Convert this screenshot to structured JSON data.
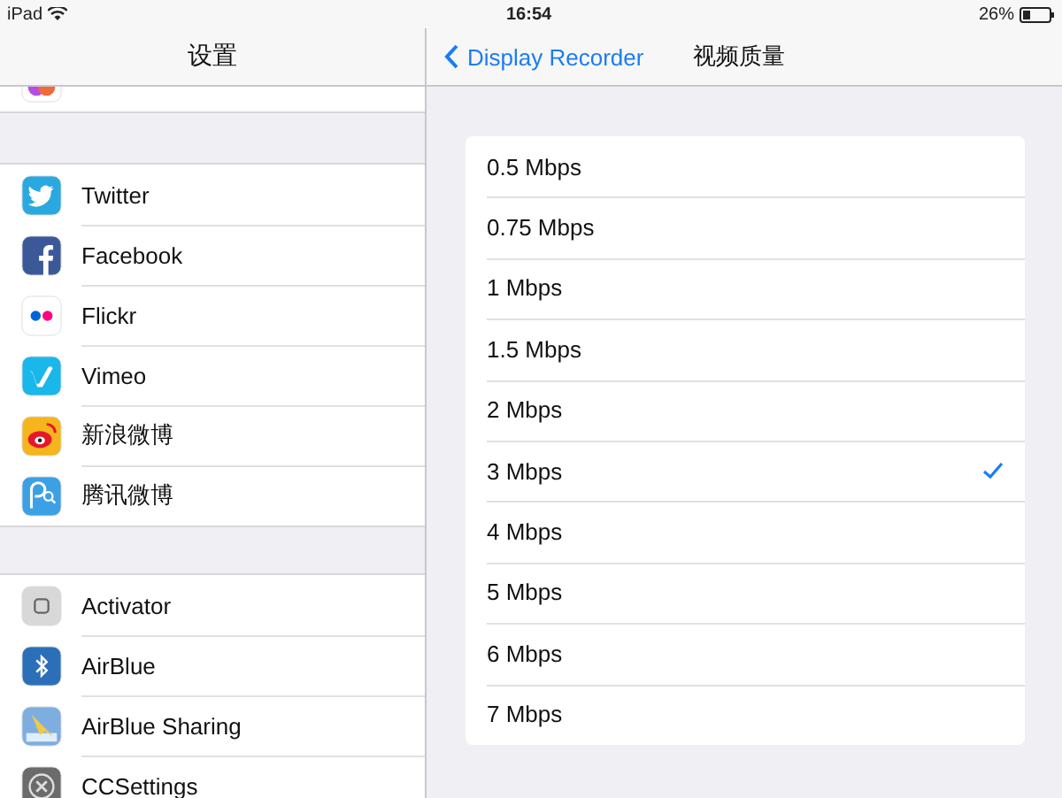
{
  "status_bar": {
    "device": "iPad",
    "time": "16:54",
    "battery": "26%"
  },
  "sidebar": {
    "title": "设置",
    "groups": [
      {
        "items": [
          {
            "label": "Twitter"
          },
          {
            "label": "Facebook"
          },
          {
            "label": "Flickr"
          },
          {
            "label": "Vimeo"
          },
          {
            "label": "新浪微博"
          },
          {
            "label": "腾讯微博"
          }
        ]
      },
      {
        "items": [
          {
            "label": "Activator"
          },
          {
            "label": "AirBlue"
          },
          {
            "label": "AirBlue Sharing"
          },
          {
            "label": "CCSettings"
          }
        ]
      }
    ]
  },
  "detail": {
    "back": "Display Recorder",
    "title": "视频质量",
    "options": [
      {
        "label": "0.5 Mbps",
        "selected": false
      },
      {
        "label": "0.75 Mbps",
        "selected": false
      },
      {
        "label": "1 Mbps",
        "selected": false
      },
      {
        "label": "1.5 Mbps",
        "selected": false
      },
      {
        "label": "2 Mbps",
        "selected": false
      },
      {
        "label": "3 Mbps",
        "selected": true
      },
      {
        "label": "4 Mbps",
        "selected": false
      },
      {
        "label": "5 Mbps",
        "selected": false
      },
      {
        "label": "6 Mbps",
        "selected": false
      },
      {
        "label": "7 Mbps",
        "selected": false
      }
    ]
  }
}
